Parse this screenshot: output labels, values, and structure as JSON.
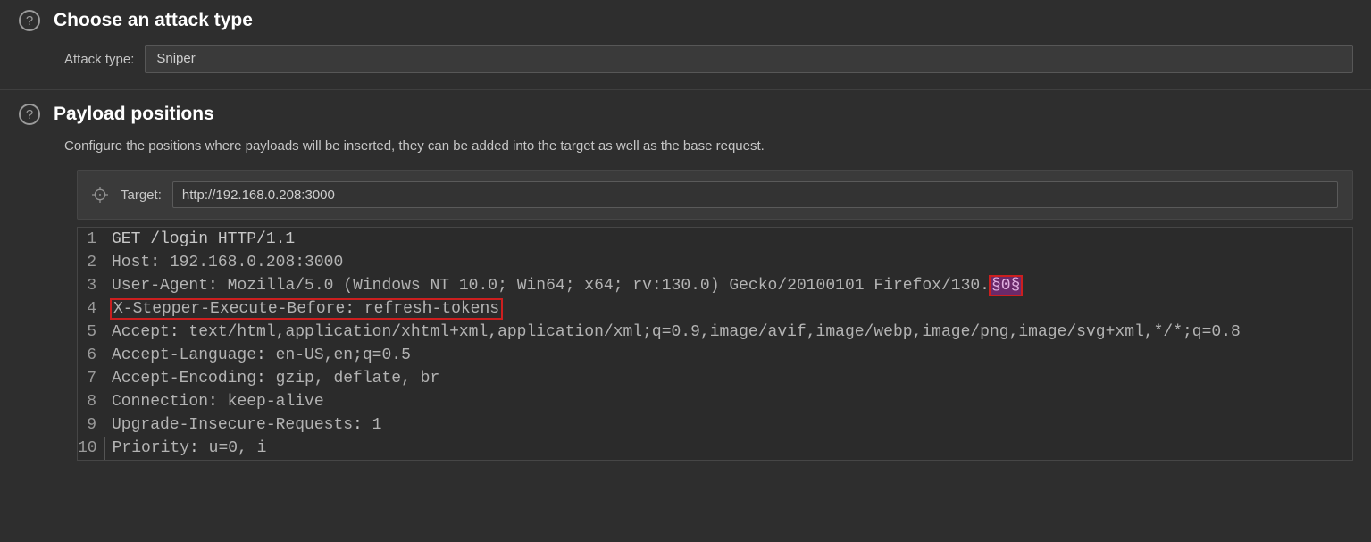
{
  "attack_type_section": {
    "title": "Choose an attack type",
    "label": "Attack type:",
    "value": "Sniper"
  },
  "payload_section": {
    "title": "Payload positions",
    "description": "Configure the positions where payloads will be inserted, they can be added into the target as well as the base request.",
    "target_label": "Target:",
    "target_value": "http://192.168.0.208:3000"
  },
  "request": {
    "marker": "§0§",
    "lines": [
      {
        "raw": "GET /login HTTP/1.1"
      },
      {
        "key": "Host",
        "val": "192.168.0.208:3000"
      },
      {
        "key": "User-Agent",
        "val": "Mozilla/5.0 (Windows NT 10.0; Win64; x64; rv:130.0) Gecko/20100101 Firefox/130.",
        "marker": true
      },
      {
        "key": "X-Stepper-Execute-Before",
        "val": "refresh-tokens",
        "highlight": true
      },
      {
        "key": "Accept",
        "val": "text/html,application/xhtml+xml,application/xml;q=0.9,image/avif,image/webp,image/png,image/svg+xml,*/*;q=0.8"
      },
      {
        "key": "Accept-Language",
        "val": "en-US,en;q=0.5"
      },
      {
        "key": "Accept-Encoding",
        "val": "gzip, deflate, br"
      },
      {
        "key": "Connection",
        "val": "keep-alive"
      },
      {
        "key": "Upgrade-Insecure-Requests",
        "val": "1"
      },
      {
        "key": "Priority",
        "val": "u=0, i"
      }
    ]
  }
}
